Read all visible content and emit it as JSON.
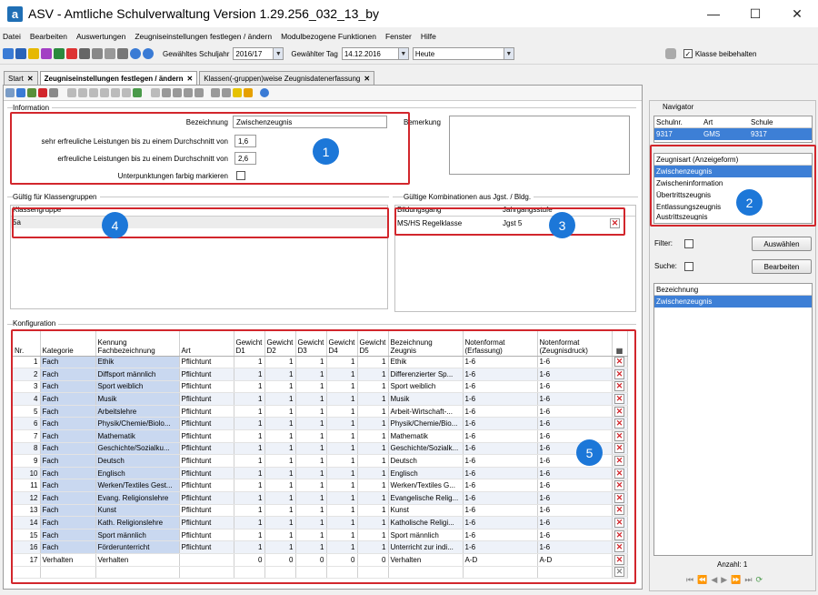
{
  "window": {
    "title": "ASV - Amtliche Schulverwaltung Version 1.29.256_032_13_by",
    "app_icon_letter": "a"
  },
  "menu": [
    "Datei",
    "Bearbeiten",
    "Auswertungen",
    "Zeugniseinstellungen festlegen / ändern",
    "Modulbezogene Funktionen",
    "Fenster",
    "Hilfe"
  ],
  "toolbar": {
    "schuljahr_label": "Gewähltes Schuljahr",
    "schuljahr_value": "2016/17",
    "tag_label": "Gewählter Tag",
    "tag_value": "14.12.2016",
    "heute_value": "Heute",
    "klasse_beibehalten": "Klasse beibehalten"
  },
  "tabs": [
    {
      "label": "Start"
    },
    {
      "label": "Zeugniseinstellungen festlegen / ändern"
    },
    {
      "label": "Klassen(-gruppen)weise Zeugnisdatenerfassung"
    }
  ],
  "information": {
    "section_title": "Information",
    "bezeichnung_label": "Bezeichnung",
    "bezeichnung_value": "Zwischenzeugnis",
    "bemerkung_label": "Bemerkung",
    "sehr_label": "sehr erfreuliche Leistungen bis zu einem Durchschnitt von",
    "sehr_value": "1,6",
    "erfreulich_label": "erfreuliche Leistungen bis zu einem Durchschnitt von",
    "erfreulich_value": "2,6",
    "unterpunktungen_label": "Unterpunktungen farbig markieren"
  },
  "klassengruppen": {
    "section_title": "Gültig für Klassengruppen",
    "column": "Klassengruppe",
    "rows": [
      "5a"
    ]
  },
  "kombinationen": {
    "section_title": "Gültige Kombinationen aus Jgst. / Bldg.",
    "col1": "Bildungsgang",
    "col2": "Jahrgangsstufe",
    "rows": [
      {
        "bildungsgang": "MS/HS Regelklasse",
        "jgst": "Jgst 5"
      }
    ]
  },
  "konfiguration": {
    "section_title": "Konfiguration",
    "headers": [
      "Nr.",
      "Kategorie",
      "Kennung\nFachbezeichnung",
      "Art",
      "Gewicht\nD1",
      "Gewicht\nD2",
      "Gewicht\nD3",
      "Gewicht\nD4",
      "Gewicht\nD5",
      "Bezeichnung\nZeugnis",
      "Notenformat\n(Erfassung)",
      "Notenformat\n(Zeugnisdruck)"
    ],
    "rows": [
      [
        "1",
        "Fach",
        "Ethik",
        "Pflichtunt",
        "1",
        "1",
        "1",
        "1",
        "1",
        "Ethik",
        "1-6",
        "1-6"
      ],
      [
        "2",
        "Fach",
        "Diffsport männlich",
        "Pflichtunt",
        "1",
        "1",
        "1",
        "1",
        "1",
        "Differenzierter Sp...",
        "1-6",
        "1-6"
      ],
      [
        "3",
        "Fach",
        "Sport weiblich",
        "Pflichtunt",
        "1",
        "1",
        "1",
        "1",
        "1",
        "Sport weiblich",
        "1-6",
        "1-6"
      ],
      [
        "4",
        "Fach",
        "Musik",
        "Pflichtunt",
        "1",
        "1",
        "1",
        "1",
        "1",
        "Musik",
        "1-6",
        "1-6"
      ],
      [
        "5",
        "Fach",
        "Arbeitslehre",
        "Pflichtunt",
        "1",
        "1",
        "1",
        "1",
        "1",
        "Arbeit-Wirtschaft-...",
        "1-6",
        "1-6"
      ],
      [
        "6",
        "Fach",
        "Physik/Chemie/Biolo...",
        "Pflichtunt",
        "1",
        "1",
        "1",
        "1",
        "1",
        "Physik/Chemie/Bio...",
        "1-6",
        "1-6"
      ],
      [
        "7",
        "Fach",
        "Mathematik",
        "Pflichtunt",
        "1",
        "1",
        "1",
        "1",
        "1",
        "Mathematik",
        "1-6",
        "1-6"
      ],
      [
        "8",
        "Fach",
        "Geschichte/Sozialku...",
        "Pflichtunt",
        "1",
        "1",
        "1",
        "1",
        "1",
        "Geschichte/Sozialk...",
        "1-6",
        "1-6"
      ],
      [
        "9",
        "Fach",
        "Deutsch",
        "Pflichtunt",
        "1",
        "1",
        "1",
        "1",
        "1",
        "Deutsch",
        "1-6",
        "1-6"
      ],
      [
        "10",
        "Fach",
        "Englisch",
        "Pflichtunt",
        "1",
        "1",
        "1",
        "1",
        "1",
        "Englisch",
        "1-6",
        "1-6"
      ],
      [
        "11",
        "Fach",
        "Werken/Textiles Gest...",
        "Pflichtunt",
        "1",
        "1",
        "1",
        "1",
        "1",
        "Werken/Textiles G...",
        "1-6",
        "1-6"
      ],
      [
        "12",
        "Fach",
        "Evang. Religionslehre",
        "Pflichtunt",
        "1",
        "1",
        "1",
        "1",
        "1",
        "Evangelische Relig...",
        "1-6",
        "1-6"
      ],
      [
        "13",
        "Fach",
        "Kunst",
        "Pflichtunt",
        "1",
        "1",
        "1",
        "1",
        "1",
        "Kunst",
        "1-6",
        "1-6"
      ],
      [
        "14",
        "Fach",
        "Kath. Religionslehre",
        "Pflichtunt",
        "1",
        "1",
        "1",
        "1",
        "1",
        "Katholische Religi...",
        "1-6",
        "1-6"
      ],
      [
        "15",
        "Fach",
        "Sport männlich",
        "Pflichtunt",
        "1",
        "1",
        "1",
        "1",
        "1",
        "Sport männlich",
        "1-6",
        "1-6"
      ],
      [
        "16",
        "Fach",
        "Förderunterricht",
        "Pflichtunt",
        "1",
        "1",
        "1",
        "1",
        "1",
        "Unterricht zur indi...",
        "1-6",
        "1-6"
      ],
      [
        "17",
        "Verhalten",
        "Verhalten",
        "",
        "0",
        "0",
        "0",
        "0",
        "0",
        "Verhalten",
        "A-D",
        "A-D"
      ]
    ]
  },
  "navigator": {
    "title": "Navigator",
    "school_headers": [
      "Schulnr.",
      "Art",
      "Schule"
    ],
    "school_row": [
      "9317",
      "GMS",
      "9317"
    ],
    "zeugnisart_header": "Zeugnisart (Anzeigeform)",
    "zeugnisart_items": [
      "Zwischenzeugnis",
      "Zwischeninformation",
      "Übertrittszeugnis",
      "Entlassungszeugnis",
      "Austrittszeugnis"
    ],
    "filter_label": "Filter:",
    "suche_label": "Suche:",
    "auswaehlen": "Auswählen",
    "bearbeiten": "Bearbeiten",
    "bezeichnung_header": "Bezeichnung",
    "bezeichnung_items": [
      "Zwischenzeugnis"
    ],
    "anzahl": "Anzahl: 1"
  },
  "badges": [
    "1",
    "2",
    "3",
    "4",
    "5"
  ],
  "colors": {
    "highlight_red": "#d2262c",
    "badge_blue": "#1c77d8",
    "selection_blue": "#3d7fd6"
  }
}
